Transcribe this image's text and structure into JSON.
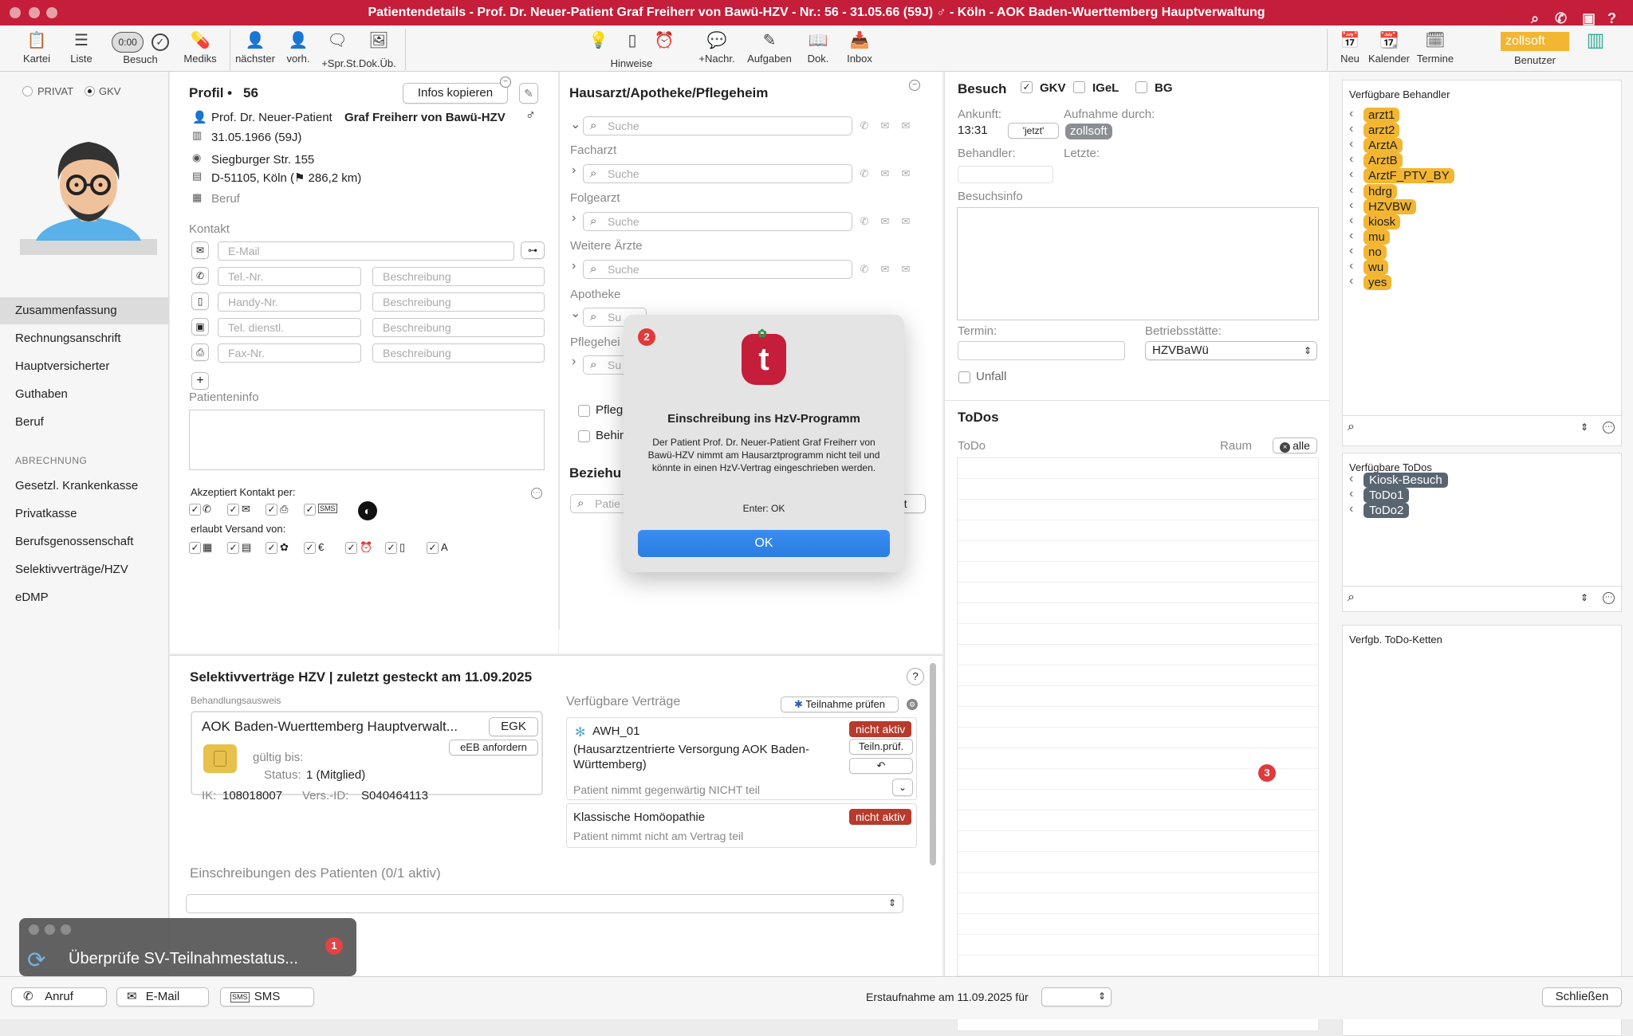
{
  "window": {
    "title": "Patientendetails - Prof. Dr. Neuer-Patient Graf Freiherr von Bawü-HZV - Nr.: 56 - 31.05.66 (59J) ♂ - Köln - AOK Baden-Wuerttemberg Hauptverwaltung"
  },
  "toolbar": {
    "kartei": "Kartei",
    "liste": "Liste",
    "timer": "0:00",
    "besuch": "Besuch",
    "mediks": "Mediks",
    "naechster": "nächster",
    "vorh": "vorh.",
    "spr": "+Spr.St.Dok.Üb.",
    "hinweise": "Hinweise",
    "nachr": "+Nachr.",
    "aufgaben": "Aufgaben",
    "dok": "Dok.",
    "inbox": "Inbox",
    "neu": "Neu",
    "kalender": "Kalender",
    "termine": "Termine",
    "benutzer": "Benutzer",
    "user_value": "zollsoft"
  },
  "left": {
    "privat": "PRIVAT",
    "gkv": "GKV",
    "nav": [
      "Zusammenfassung",
      "Rechnungsanschrift",
      "Hauptversicherter",
      "Guthaben",
      "Beruf"
    ],
    "abrechnung": "ABRECHNUNG",
    "nav2": [
      "Gesetzl. Krankenkasse",
      "Privatkasse",
      "Berufsgenossenschaft",
      "Selektivverträge/HZV",
      "eDMP"
    ]
  },
  "profile": {
    "title": "Profil •",
    "number": "56",
    "copy_btn": "Infos kopieren",
    "name_prefix": "Prof. Dr. Neuer-Patient",
    "name_bold": "Graf Freiherr von Bawü-HZV",
    "dob": "31.05.1966 (59J)",
    "street": "Siegburger Str. 155",
    "city": "D-51105, Köln (⚑ 286,2 km)",
    "beruf": "Beruf",
    "kontakt": "Kontakt",
    "email_ph": "E-Mail",
    "tel_ph": "Tel.-Nr.",
    "handy_ph": "Handy-Nr.",
    "dienst_ph": "Tel. dienstl.",
    "fax_ph": "Fax-Nr.",
    "beschreibung": "Beschreibung",
    "patienteninfo": "Patienteninfo",
    "akzeptiert": "Akzeptiert Kontakt per:",
    "versand": "erlaubt Versand von:",
    "sms": "SMS"
  },
  "hausarzt": {
    "title": "Hausarzt/Apotheke/Pflegeheim",
    "search": "Suche",
    "facharzt": "Facharzt",
    "folgearzt": "Folgearzt",
    "weitere": "Weitere Ärzte",
    "apotheke": "Apotheke",
    "pflegeheim": "Pflegehei",
    "su": "Su",
    "pfleg": "Pfleg",
    "behin": "Behin",
    "beziehu": "Beziehu",
    "patie": "Patie",
    "nt": "nt"
  },
  "besuch": {
    "title": "Besuch",
    "gkv": "GKV",
    "igel": "IGeL",
    "bg": "BG",
    "ankunft": "Ankunft:",
    "time": "13:31",
    "jetzt": "'jetzt'",
    "aufnahme": "Aufnahme durch:",
    "aufnahme_user": "zollsoft",
    "behandler": "Behandler:",
    "letzte": "Letzte:",
    "besuchsinfo": "Besuchsinfo",
    "termin": "Termin:",
    "betriebsstaette": "Betriebsstätte:",
    "betriebsstaette_value": "HZVBaWü",
    "unfall": "Unfall"
  },
  "todos": {
    "title": "ToDos",
    "todo": "ToDo",
    "raum": "Raum",
    "alle": "alle"
  },
  "right": {
    "behandler_title": "Verfügbare Behandler",
    "behandler": [
      "arzt1",
      "arzt2",
      "ArztA",
      "ArztB",
      "ArztF_PTV_BY",
      "hdrg",
      "HZVBW",
      "kiosk",
      "mu",
      "no",
      "wu",
      "yes"
    ],
    "todos_title": "Verfügbare ToDos",
    "todos": [
      "Kiosk-Besuch",
      "ToDo1",
      "ToDo2"
    ],
    "ketten_title": "Verfgb. ToDo-Ketten"
  },
  "sv": {
    "title": "Selektivverträge HZV | zuletzt gesteckt am 11.09.2025",
    "ausweis": "Behandlungsausweis",
    "kasse": "AOK Baden-Wuerttemberg Hauptverwalt...",
    "egk": "EGK",
    "eb": "eEB anfordern",
    "gueltig": "gültig bis:",
    "status_lbl": "Status:",
    "status_val": "1 (Mitglied)",
    "ik_lbl": "IK:",
    "ik": "108018007",
    "vers_lbl": "Vers.-ID:",
    "vers": "S040464113",
    "verfuegbar": "Verfügbare Verträge",
    "teilnahme": "Teilnahme prüfen",
    "awh": "AWH_01",
    "awh_desc": "(Hausarztzentrierte Versorgung AOK Baden-Württemberg)",
    "nicht_aktiv": "nicht aktiv",
    "teiln": "Teiln.prüf.",
    "awh_note": "Patient nimmt gegenwärtig NICHT teil",
    "klassisch": "Klassische Homöopathie",
    "klassisch_note": "Patient nimmt nicht am Vertrag teil",
    "einschreibungen": "Einschreibungen des Patienten (0/1 aktiv)"
  },
  "modal": {
    "title": "Einschreibung ins HzV-Programm",
    "text": "Der Patient Prof. Dr. Neuer-Patient Graf Freiherr von Bawü-HZV nimmt am Hausarztprogramm nicht teil und könnte in einen HzV-Vertrag eingeschrieben werden.",
    "hint": "Enter: OK",
    "ok": "OK",
    "logo": "t"
  },
  "toast": {
    "text": "Überprüfe SV-Teilnahmestatus..."
  },
  "badges": [
    "1",
    "2",
    "3"
  ],
  "bottom": {
    "anruf": "Anruf",
    "email": "E-Mail",
    "sms": "SMS",
    "erstaufnahme": "Erstaufnahme am 11.09.2025 für",
    "schliessen": "Schließen"
  },
  "colors": {
    "title_bar": "#c41e3a",
    "tag": "#f2b632",
    "todo_tag": "#5a6572",
    "ok": "#2a7de1",
    "nicht_aktiv": "#b73a2c"
  }
}
